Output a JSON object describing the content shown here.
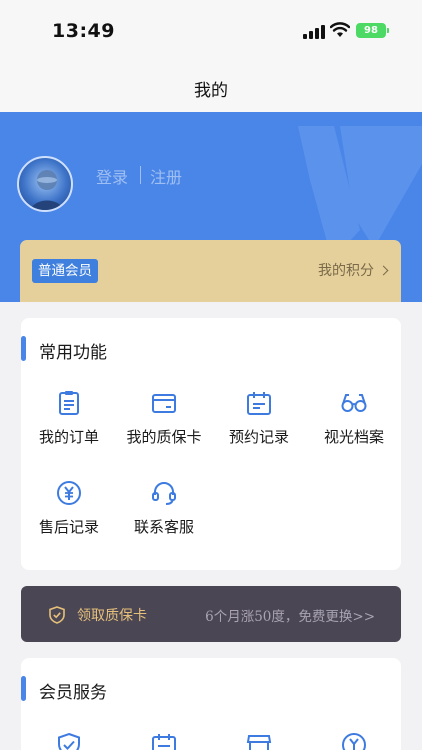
{
  "status_bar": {
    "time": "13:49",
    "battery": "98"
  },
  "nav": {
    "title": "我的"
  },
  "header": {
    "login": "登录",
    "register": "注册"
  },
  "member": {
    "level": "普通会员",
    "points_link": "我的积分"
  },
  "common_functions": {
    "title": "常用功能",
    "items": [
      {
        "label": "我的订单",
        "icon": "clipboard-icon"
      },
      {
        "label": "我的质保卡",
        "icon": "card-icon"
      },
      {
        "label": "预约记录",
        "icon": "calendar-icon"
      },
      {
        "label": "视光档案",
        "icon": "glasses-icon"
      },
      {
        "label": "售后记录",
        "icon": "yen-circle-icon"
      },
      {
        "label": "联系客服",
        "icon": "headset-icon"
      }
    ]
  },
  "warranty_banner": {
    "title": "领取质保卡",
    "subtitle": "6个月涨50度，免费更换>>"
  },
  "member_services": {
    "title": "会员服务",
    "icons": [
      "shield-check-icon",
      "calendar-icon",
      "store-icon",
      "yen-circle-icon"
    ]
  },
  "colors": {
    "brand_blue": "#4a86e8",
    "gold": "#e5d09c",
    "banner_dark": "#4a4654"
  }
}
